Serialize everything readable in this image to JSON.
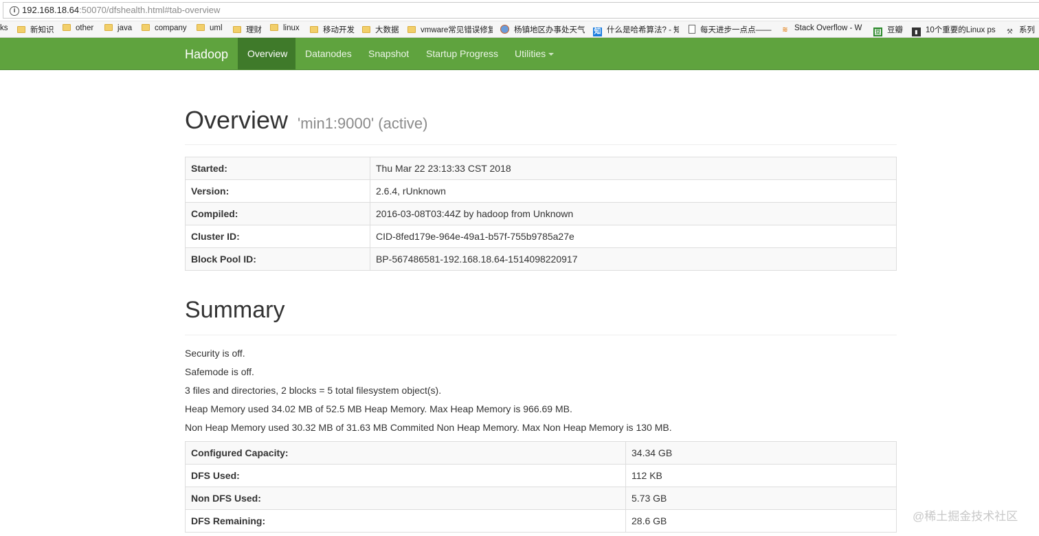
{
  "browser": {
    "url_host": "192.168.18.64",
    "url_rest": ":50070/dfshealth.html#tab-overview",
    "bookmarks": [
      {
        "label": "ks",
        "icon": "none"
      },
      {
        "label": "新知识",
        "icon": "folder-icon"
      },
      {
        "label": "other",
        "icon": "folder-icon"
      },
      {
        "label": "java",
        "icon": "folder-icon"
      },
      {
        "label": "company",
        "icon": "folder-icon"
      },
      {
        "label": "uml",
        "icon": "folder-icon"
      },
      {
        "label": "理财",
        "icon": "folder-icon"
      },
      {
        "label": "linux",
        "icon": "folder-icon"
      },
      {
        "label": "移动开发",
        "icon": "folder-icon"
      },
      {
        "label": "大数据",
        "icon": "folder-icon"
      },
      {
        "label": "vmware常见错误修复",
        "icon": "folder-icon"
      },
      {
        "label": "杨镇地区办事处天气",
        "icon": "globe-icon"
      },
      {
        "label": "什么是哈希算法? - 知",
        "icon": "zhihu-icon"
      },
      {
        "label": "每天进步一点点——",
        "icon": "document-icon"
      },
      {
        "label": "Stack Overflow - W",
        "icon": "stackoverflow-icon"
      },
      {
        "label": "豆瓣",
        "icon": "douban-icon"
      },
      {
        "label": "10个重要的Linux ps",
        "icon": "bookmark-icon"
      },
      {
        "label": "系列",
        "icon": "tool-icon"
      }
    ]
  },
  "navbar": {
    "brand": "Hadoop",
    "items": [
      "Overview",
      "Datanodes",
      "Snapshot",
      "Startup Progress",
      "Utilities"
    ],
    "active": "Overview",
    "color": "#5fa33e"
  },
  "overview": {
    "title": "Overview",
    "subtitle": "'min1:9000' (active)",
    "rows": [
      {
        "key": "Started:",
        "value": "Thu Mar 22 23:13:33 CST 2018"
      },
      {
        "key": "Version:",
        "value": "2.6.4, rUnknown"
      },
      {
        "key": "Compiled:",
        "value": "2016-03-08T03:44Z by hadoop from Unknown"
      },
      {
        "key": "Cluster ID:",
        "value": "CID-8fed179e-964e-49a1-b57f-755b9785a27e"
      },
      {
        "key": "Block Pool ID:",
        "value": "BP-567486581-192.168.18.64-1514098220917"
      }
    ]
  },
  "summary": {
    "title": "Summary",
    "lines": [
      "Security is off.",
      "Safemode is off.",
      "3 files and directories, 2 blocks = 5 total filesystem object(s).",
      "Heap Memory used 34.02 MB of 52.5 MB Heap Memory. Max Heap Memory is 966.69 MB.",
      "Non Heap Memory used 30.32 MB of 31.63 MB Commited Non Heap Memory. Max Non Heap Memory is 130 MB."
    ],
    "rows": [
      {
        "key": "Configured Capacity:",
        "value": "34.34 GB"
      },
      {
        "key": "DFS Used:",
        "value": "112 KB"
      },
      {
        "key": "Non DFS Used:",
        "value": "5.73 GB"
      },
      {
        "key": "DFS Remaining:",
        "value": "28.6 GB"
      }
    ]
  },
  "watermark": "@稀土掘金技术社区"
}
